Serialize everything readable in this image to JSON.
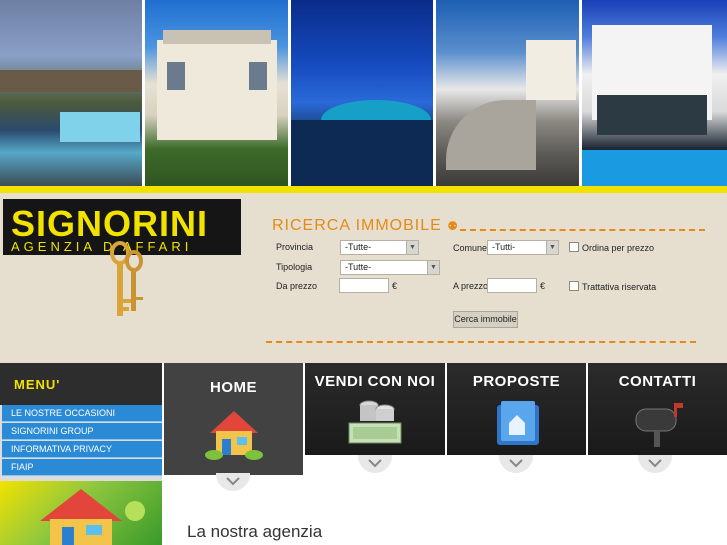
{
  "logo": {
    "name": "SIGNORINI",
    "tagline": "AGENZIA D'AFFARI"
  },
  "search": {
    "title": "RICERCA IMMOBILE",
    "provincia_label": "Provincia",
    "provincia_value": "-Tutte-",
    "comune_label": "Comune",
    "comune_value": "-Tutti-",
    "ordina_label": "Ordina per prezzo",
    "tipologia_label": "Tipologia",
    "tipologia_value": "-Tutte-",
    "da_prezzo_label": "Da prezzo",
    "a_prezzo_label": "A prezzo",
    "currency": "€",
    "trattativa_label": "Trattativa riservata",
    "submit_label": "Cerca immobile"
  },
  "menu": {
    "title": "MENU'",
    "items": [
      "LE NOSTRE OCCASIONI",
      "SIGNORINI GROUP",
      "INFORMATIVA PRIVACY",
      "FIAIP"
    ]
  },
  "tabs": [
    {
      "label": "HOME",
      "icon": "house-icon"
    },
    {
      "label": "VENDI CON NOI",
      "icon": "money-stack-icon"
    },
    {
      "label": "PROPOSTE",
      "icon": "folder-icon"
    },
    {
      "label": "CONTATTI",
      "icon": "mailbox-icon"
    }
  ],
  "content": {
    "title": "La nostra agenzia"
  },
  "colors": {
    "accent_yellow": "#f2e200",
    "accent_orange": "#e58a16",
    "menu_blue": "#2a8ad6",
    "panel_beige": "#e6dfcf"
  }
}
